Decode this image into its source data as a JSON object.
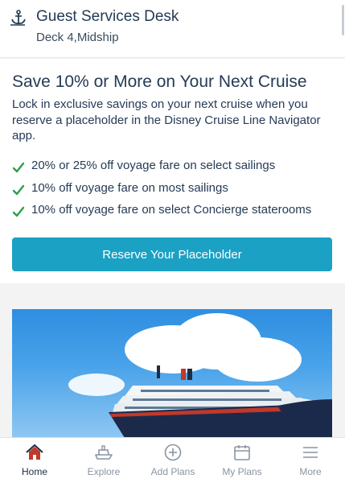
{
  "location": {
    "icon": "anchor-icon",
    "title": "Guest Services Desk",
    "subtitle": "Deck 4,Midship"
  },
  "promo": {
    "headline": "Save 10% or More on Your Next Cruise",
    "description": "Lock in exclusive savings on your next cruise when you reserve a placeholder in the Disney Cruise Line Navigator app.",
    "benefits": [
      "20% or 25% off voyage fare on select sailings",
      "10% off voyage fare on most sailings",
      "10% off voyage fare on select Concierge staterooms"
    ],
    "cta_label": "Reserve Your Placeholder",
    "check_color": "#2e9f48",
    "cta_color": "#1ba1c4"
  },
  "hero_image": {
    "subject": "cruise ship under blue sky with clouds"
  },
  "tabbar": {
    "tabs": [
      {
        "label": "Home",
        "icon": "home-icon",
        "active": true
      },
      {
        "label": "Explore",
        "icon": "ship-icon",
        "active": false
      },
      {
        "label": "Add Plans",
        "icon": "plus-circle-icon",
        "active": false
      },
      {
        "label": "My Plans",
        "icon": "calendar-icon",
        "active": false
      },
      {
        "label": "More",
        "icon": "menu-icon",
        "active": false
      }
    ]
  }
}
